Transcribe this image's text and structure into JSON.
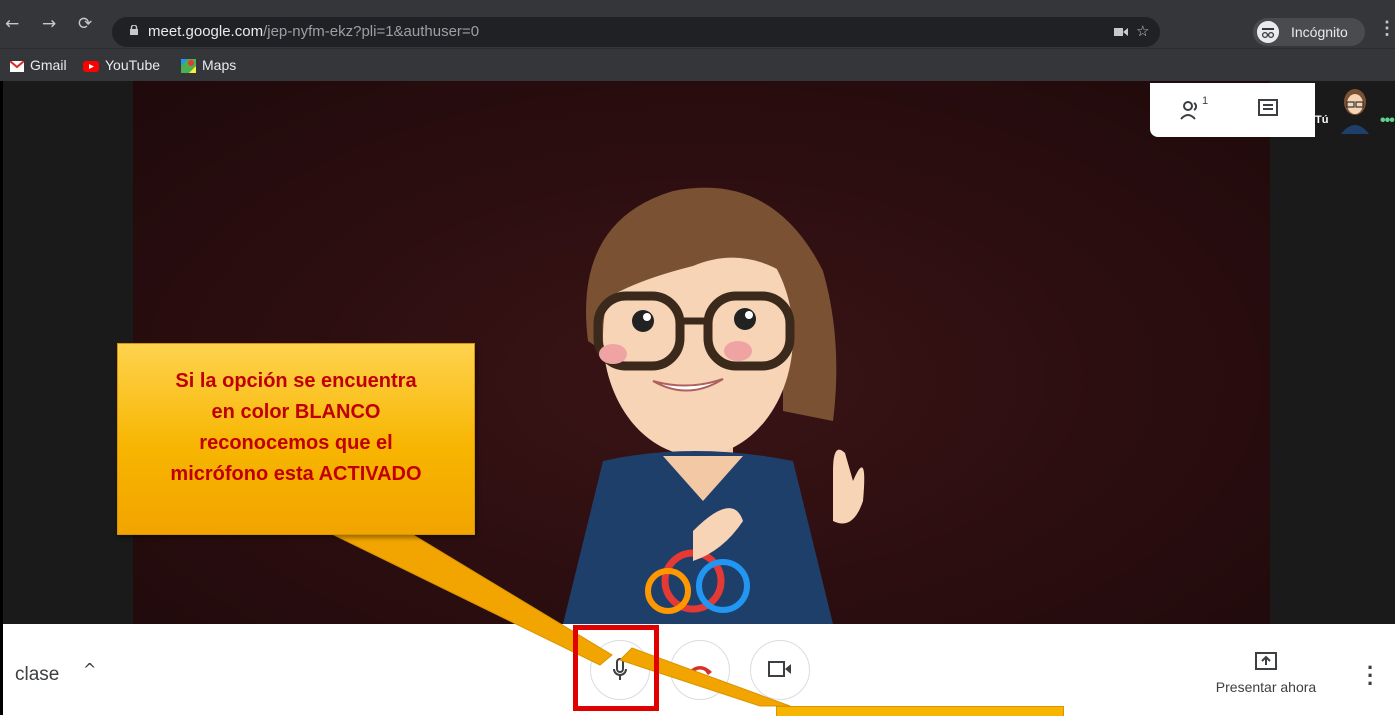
{
  "browser": {
    "url_host": "meet.google.com",
    "url_path": "/jep-nyfm-ekz?pli=1&authuser=0",
    "incognito_label": "Incógnito"
  },
  "bookmarks": [
    {
      "label": "Gmail",
      "icon": "gmail-icon"
    },
    {
      "label": "YouTube",
      "icon": "youtube-icon"
    },
    {
      "label": "Maps",
      "icon": "maps-icon"
    }
  ],
  "meet": {
    "participants_count": "1",
    "self_label": "Tú",
    "meeting_name": "clase",
    "present_label": "Presentar ahora"
  },
  "callout": {
    "lines": [
      "Si la opción se encuentra",
      "en color BLANCO",
      "reconocemos que el",
      "micrófono esta ACTIVADO"
    ]
  },
  "colors": {
    "browser_bg": "#35363a",
    "hangup_red": "#d93025",
    "callout_fill": "#f7b500",
    "callout_text": "#c00000",
    "highlight_box": "#e00000"
  }
}
